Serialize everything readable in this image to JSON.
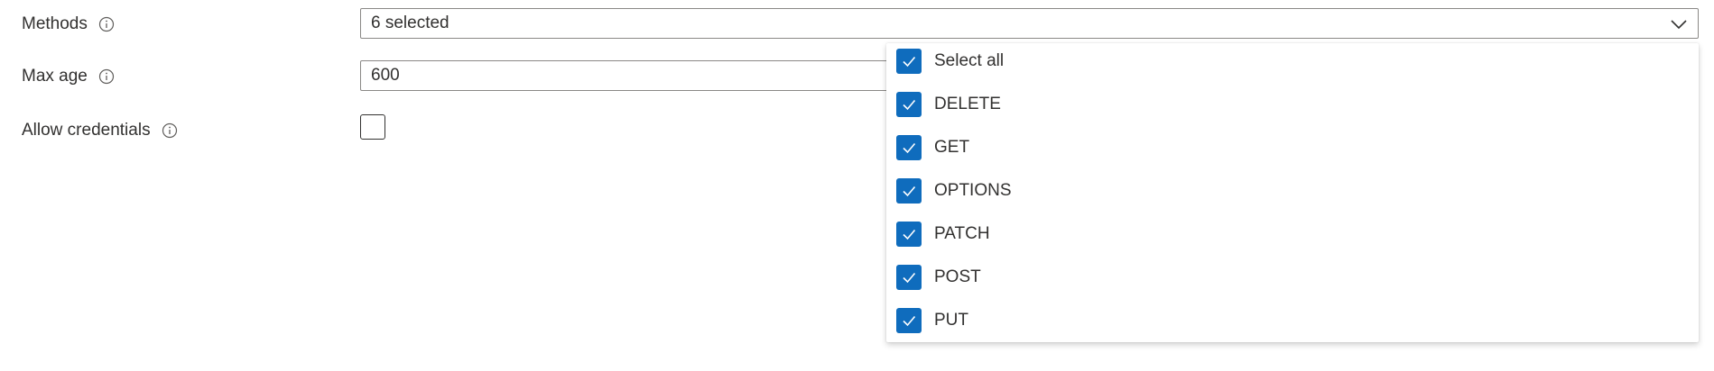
{
  "form": {
    "methods": {
      "label": "Methods",
      "value": "6 selected",
      "options": [
        {
          "label": "Select all",
          "checked": true
        },
        {
          "label": "DELETE",
          "checked": true
        },
        {
          "label": "GET",
          "checked": true
        },
        {
          "label": "OPTIONS",
          "checked": true
        },
        {
          "label": "PATCH",
          "checked": true
        },
        {
          "label": "POST",
          "checked": true
        },
        {
          "label": "PUT",
          "checked": true
        }
      ]
    },
    "max_age": {
      "label": "Max age",
      "value": "600"
    },
    "allow_credentials": {
      "label": "Allow credentials",
      "checked": false
    }
  },
  "colors": {
    "checkbox_checked": "#0f6cbd",
    "text": "#323130",
    "border": "#8a8886"
  },
  "icons": {
    "info": "info-icon",
    "chevron": "chevron-down-icon",
    "check": "checkmark-icon"
  }
}
